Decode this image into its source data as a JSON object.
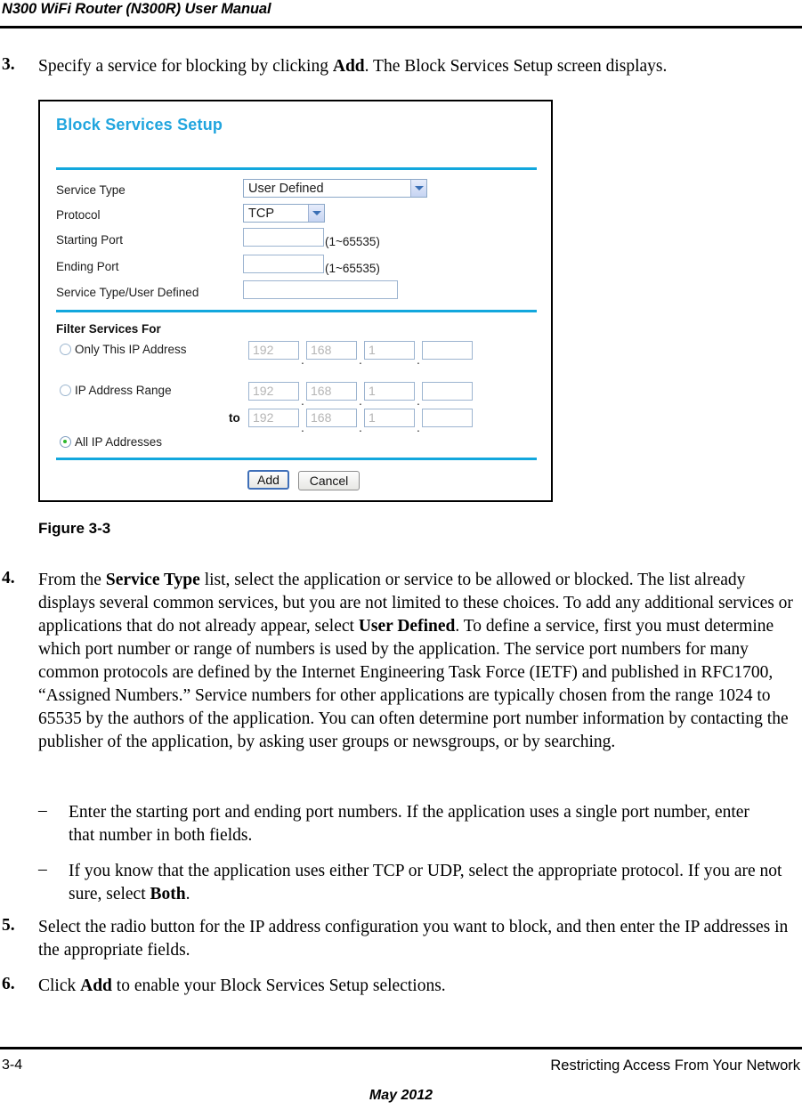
{
  "header": {
    "running_head": "N300 WiFi Router (N300R) User Manual"
  },
  "steps": {
    "step3": {
      "num": "3.",
      "text_before": "Specify a service for blocking by clicking ",
      "bold": "Add",
      "text_after": ". The Block Services Setup screen displays."
    },
    "step4": {
      "num": "4.",
      "t1": "From the ",
      "b1": "Service Type",
      "t2": " list, select the application or service to be allowed or blocked. The list already displays several common services, but you are not limited to these choices. To add any additional services or applications that do not already appear, select ",
      "b2": "User Defined",
      "t3": ". To define a service, first you must determine which port number or range of numbers is used by the application. The service port numbers for many common protocols are defined by the Internet Engineering Task Force (IETF) and published in RFC1700, “Assigned Numbers.” Service numbers for other applications are typically chosen from the range 1024 to 65535 by the authors of the application. You can often determine port number information by contacting the publisher of the application, by asking user groups or newsgroups, or by searching."
    },
    "dash1": {
      "dash": "–",
      "text": "Enter the starting port and ending port numbers. If the application uses a single port number, enter that number in both fields."
    },
    "dash2": {
      "dash": "–",
      "t1": "If you know that the application uses either TCP or UDP, select the appropriate protocol. If you are not sure, select ",
      "b1": "Both",
      "t2": "."
    },
    "step5": {
      "num": "5.",
      "text": "Select the radio button for the IP address configuration you want to block, and then enter the IP addresses in the appropriate fields."
    },
    "step6": {
      "num": "6.",
      "t1": "Click ",
      "b1": "Add",
      "t2": " to enable your Block Services Setup selections."
    }
  },
  "figure": {
    "caption": "Figure 3-3",
    "ui": {
      "title": "Block Services Setup",
      "accent_color": "#12a7dd",
      "fields": {
        "service_type": {
          "label": "Service Type",
          "value": "User Defined"
        },
        "protocol": {
          "label": "Protocol",
          "value": "TCP"
        },
        "starting_port": {
          "label": "Starting Port",
          "value": "",
          "hint": "(1~65535)"
        },
        "ending_port": {
          "label": "Ending Port",
          "value": "",
          "hint": "(1~65535)"
        },
        "service_user_defined": {
          "label": "Service Type/User Defined",
          "value": ""
        }
      },
      "filter": {
        "section_label": "Filter Services For",
        "to_label": "to",
        "separator": ".",
        "options": [
          {
            "label": "Only This IP Address",
            "selected": false,
            "octets": [
              "192",
              "168",
              "1",
              ""
            ]
          },
          {
            "label": "IP Address Range",
            "selected": false,
            "octets": [
              "192",
              "168",
              "1",
              ""
            ],
            "octets_to": [
              "192",
              "168",
              "1",
              ""
            ]
          },
          {
            "label": "All IP Addresses",
            "selected": true
          }
        ]
      },
      "buttons": {
        "add": "Add",
        "cancel": "Cancel"
      }
    }
  },
  "footer": {
    "page_number": "3-4",
    "chapter": "Restricting Access From Your Network",
    "date": "May 2012"
  }
}
